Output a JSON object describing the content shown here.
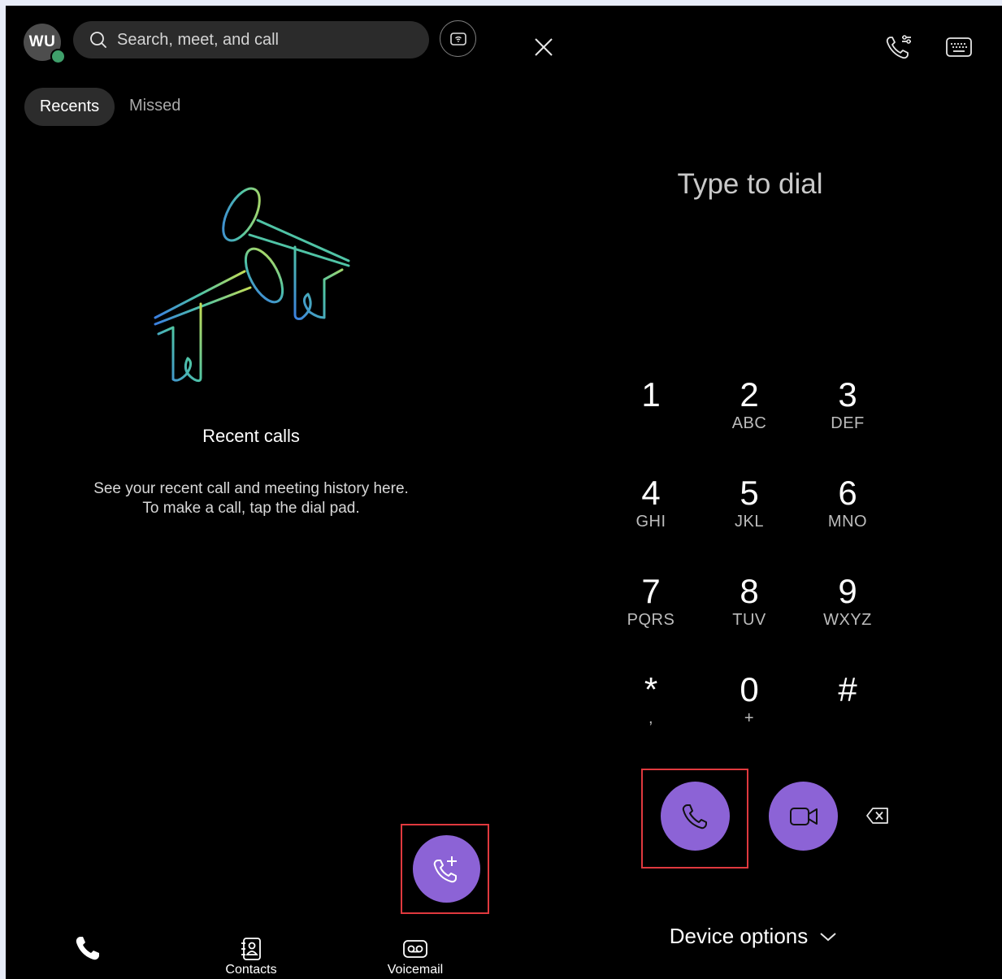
{
  "colors": {
    "background": "#000000",
    "accent_purple": "#8c63d6",
    "presence_green": "#3fa06b",
    "highlight_red": "#e0393e"
  },
  "header": {
    "avatar_initials": "WU",
    "search_placeholder": "Search, meet, and call",
    "icons": [
      "search-icon",
      "proximity-icon",
      "close-icon",
      "call-settings-icon",
      "keyboard-icon"
    ]
  },
  "tabs": [
    {
      "label": "Recents",
      "active": true
    },
    {
      "label": "Missed",
      "active": false
    }
  ],
  "empty_state": {
    "title": "Recent calls",
    "line1": "See your recent call and meeting history here.",
    "line2": "To make a call, tap the dial pad."
  },
  "bottom_nav": [
    {
      "label": "",
      "icon": "phone-icon"
    },
    {
      "label": "Contacts",
      "icon": "contacts-icon"
    },
    {
      "label": "Voicemail",
      "icon": "voicemail-icon"
    }
  ],
  "dialpad": {
    "display_placeholder": "Type to dial",
    "keys": [
      {
        "digit": "1",
        "sub": ""
      },
      {
        "digit": "2",
        "sub": "ABC"
      },
      {
        "digit": "3",
        "sub": "DEF"
      },
      {
        "digit": "4",
        "sub": "GHI"
      },
      {
        "digit": "5",
        "sub": "JKL"
      },
      {
        "digit": "6",
        "sub": "MNO"
      },
      {
        "digit": "7",
        "sub": "PQRS"
      },
      {
        "digit": "8",
        "sub": "TUV"
      },
      {
        "digit": "9",
        "sub": "WXYZ"
      },
      {
        "digit": "*",
        "sub": ","
      },
      {
        "digit": "0",
        "sub": "+"
      },
      {
        "digit": "#",
        "sub": ""
      }
    ],
    "device_options_label": "Device options"
  }
}
